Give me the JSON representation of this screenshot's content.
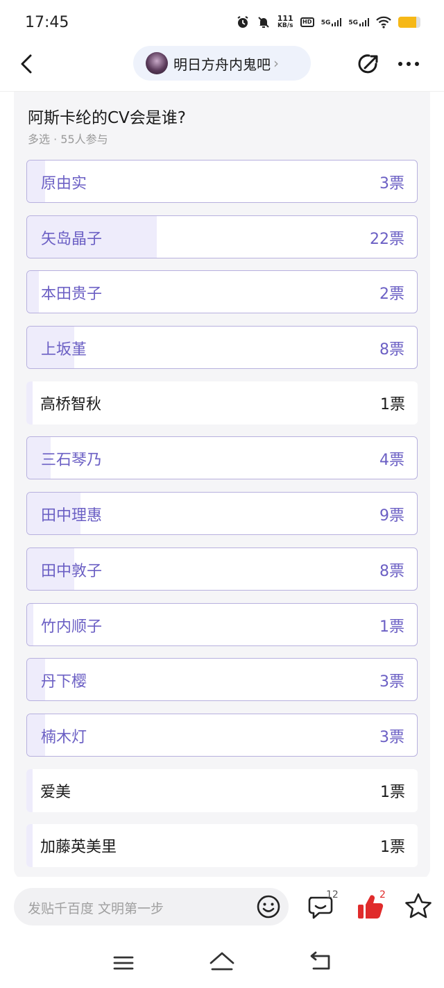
{
  "status_bar": {
    "time": "17:45",
    "net_speed_value": "111",
    "net_speed_unit": "KB/s",
    "hd_label": "HD",
    "signal1_label": "5G",
    "signal2_label": "5G",
    "battery_level": 0.8,
    "icons": [
      "alarm-icon",
      "mute-icon",
      "wifi-icon",
      "battery-icon"
    ]
  },
  "header": {
    "forum_name": "明日方舟内鬼吧",
    "forum_chevron": "›",
    "icons": [
      "back-arrow-icon",
      "share-icon",
      "more-icon"
    ]
  },
  "poll": {
    "title": "阿斯卡纶的CV会是谁?",
    "meta": "多选 · 55人参与",
    "options": [
      {
        "label": "原由实",
        "votes": "3票",
        "count": 3,
        "selected": true
      },
      {
        "label": "矢岛晶子",
        "votes": "22票",
        "count": 22,
        "selected": true
      },
      {
        "label": "本田贵子",
        "votes": "2票",
        "count": 2,
        "selected": true
      },
      {
        "label": "上坂堇",
        "votes": "8票",
        "count": 8,
        "selected": true
      },
      {
        "label": "高桥智秋",
        "votes": "1票",
        "count": 1,
        "selected": false
      },
      {
        "label": "三石琴乃",
        "votes": "4票",
        "count": 4,
        "selected": true
      },
      {
        "label": "田中理惠",
        "votes": "9票",
        "count": 9,
        "selected": true
      },
      {
        "label": "田中敦子",
        "votes": "8票",
        "count": 8,
        "selected": true
      },
      {
        "label": "竹内顺子",
        "votes": "1票",
        "count": 1,
        "selected": true
      },
      {
        "label": "丹下樱",
        "votes": "3票",
        "count": 3,
        "selected": true
      },
      {
        "label": "楠木灯",
        "votes": "3票",
        "count": 3,
        "selected": true
      },
      {
        "label": "爱美",
        "votes": "1票",
        "count": 1,
        "selected": false
      },
      {
        "label": "加藤英美里",
        "votes": "1票",
        "count": 1,
        "selected": false
      },
      {
        "label": "",
        "votes": "",
        "count": 0,
        "selected": false
      }
    ]
  },
  "bottom_bar": {
    "input_placeholder": "发贴千百度 文明第一步",
    "comment_count": "12",
    "like_count": "2",
    "icons": [
      "emoji-icon",
      "comment-icon",
      "like-icon",
      "favorite-icon"
    ]
  },
  "nav_bar": {
    "icons": [
      "menu-icon",
      "home-icon",
      "back-icon"
    ]
  },
  "colors": {
    "accent": "#6b5fc4",
    "option_fill": "#eeecfb",
    "option_border": "#b7b0de",
    "like_red": "#e02b2b",
    "battery": "#f6b817"
  }
}
